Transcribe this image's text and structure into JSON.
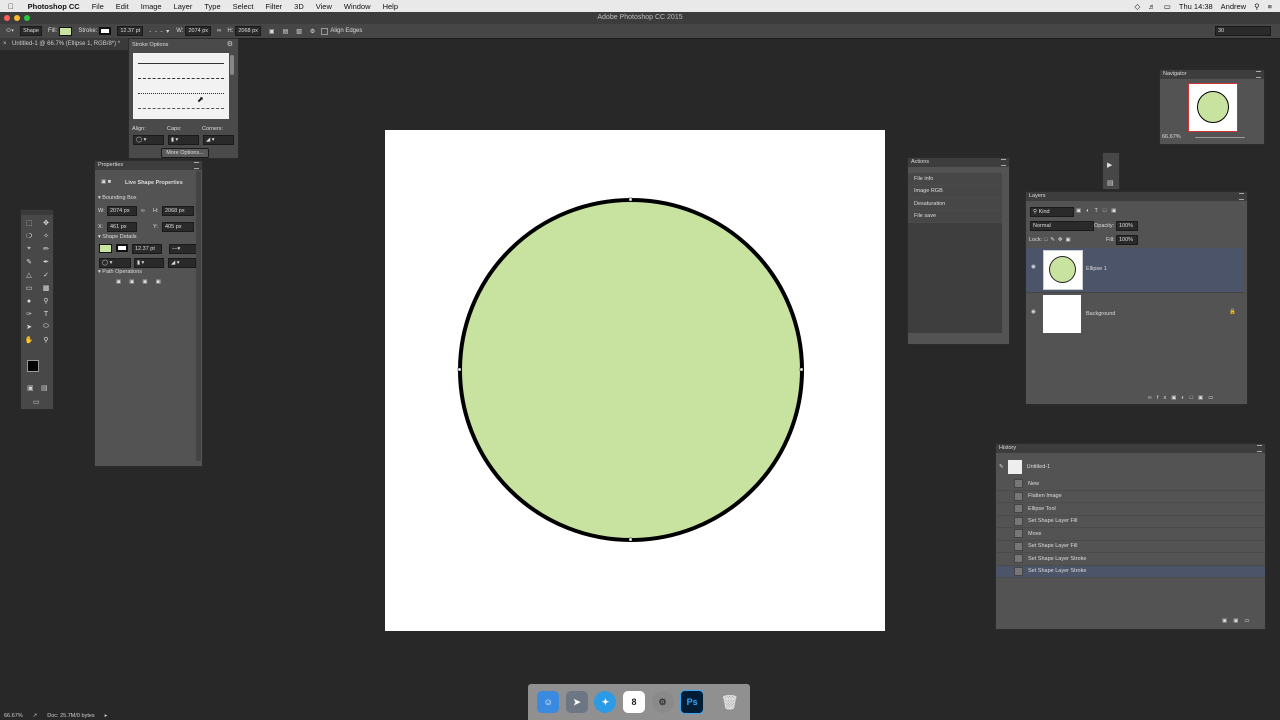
{
  "menubar": {
    "app": "Photoshop CC",
    "items": [
      "File",
      "Edit",
      "Image",
      "Layer",
      "Type",
      "Select",
      "Filter",
      "3D",
      "View",
      "Window",
      "Help"
    ],
    "clock": "Thu 14:38",
    "user": "Andrew"
  },
  "window_title": "Adobe Photoshop CC 2015",
  "options": {
    "tool": "Shape",
    "fill_label": "Fill:",
    "stroke_label": "Stroke:",
    "stroke_width": "12.37 pt",
    "w_label": "W:",
    "w_value": "2074 px",
    "h_label": "H:",
    "h_value": "2068 px",
    "align_edges": "Align Edges",
    "right_value": "30"
  },
  "document_tab": "Untitled-1 @ 66.7% (Ellipse 1, RGB/8*) *",
  "stroke_options": {
    "title": "Stroke Options",
    "align_label": "Align:",
    "caps_label": "Caps:",
    "corners_label": "Corners:",
    "more_button": "More Options..."
  },
  "properties": {
    "title": "Properties",
    "heading": "Live Shape Properties",
    "bounding_box": "Bounding Box",
    "w_label": "W:",
    "w_value": "2074 px",
    "h_label": "H:",
    "h_value": "2068 px",
    "x_label": "X:",
    "x_value": "461 px",
    "y_label": "Y:",
    "y_value": "405 px",
    "shape_details": "Shape Details",
    "stroke_value": "12.37 pt",
    "path_operations": "Path Operations"
  },
  "navigator": {
    "title": "Navigator",
    "zoom": "66.67%"
  },
  "actions": {
    "title": "Actions",
    "items": [
      "File info",
      "Image RGB",
      "Desaturation",
      "File save"
    ]
  },
  "layers": {
    "title": "Layers",
    "kind": "Kind",
    "blend": "Normal",
    "opacity_label": "Opacity:",
    "opacity": "100%",
    "lock_label": "Lock:",
    "fill_label": "Fill:",
    "fill": "100%",
    "items": [
      {
        "name": "Ellipse 1",
        "selected": true
      },
      {
        "name": "Background",
        "selected": false
      }
    ]
  },
  "history": {
    "title": "History",
    "snapshot": "Untitled-1",
    "items": [
      "New",
      "Flatten Image",
      "Ellipse Tool",
      "Set Shape Layer Fill",
      "Move",
      "Set Shape Layer Fill",
      "Set Shape Layer Stroke",
      "Set Shape Layer Stroke"
    ],
    "selected_index": 7
  },
  "status": {
    "zoom": "66.67%",
    "doc": "Doc: 25.7M/0 bytes"
  },
  "colors": {
    "shape_fill": "#c8e2a0",
    "stroke": "#000000",
    "selection": "#4b5468"
  },
  "dock": {
    "calendar_day": "8",
    "ps_label": "Ps"
  }
}
